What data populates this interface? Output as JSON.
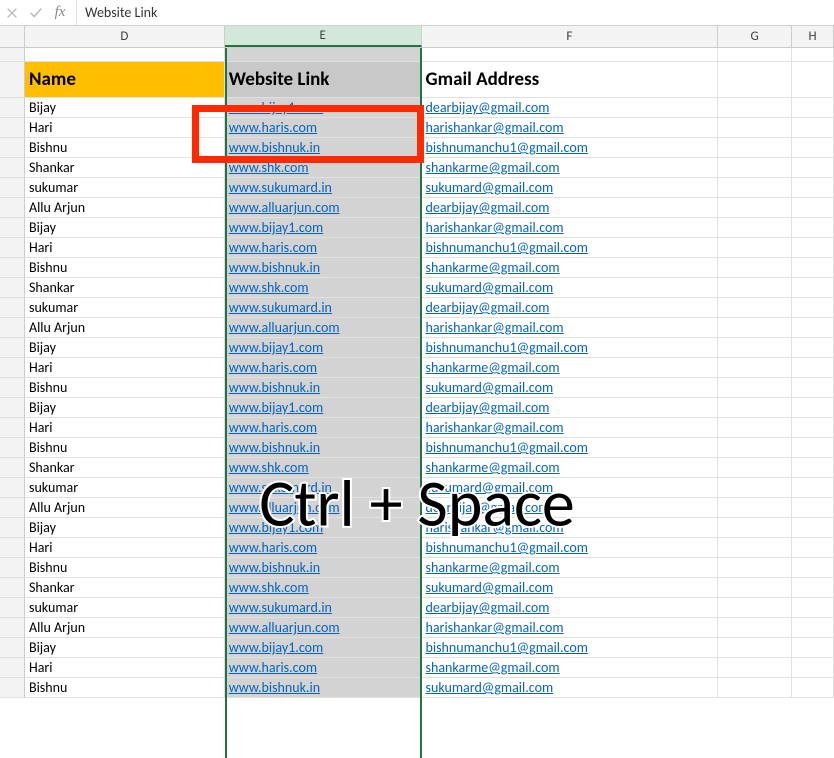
{
  "formula_bar": {
    "value": "Website Link",
    "fx": "fx"
  },
  "columns": {
    "D": "D",
    "E": "E",
    "F": "F",
    "G": "G",
    "H": "H"
  },
  "headers": {
    "name": "Name",
    "link": "Website Link",
    "email": "Gmail Address"
  },
  "overlay": "Ctrl + Space",
  "rows": [
    {
      "name": "Bijay",
      "link": "www.bijay1.com",
      "email": "dearbijay@gmail.com"
    },
    {
      "name": "Hari",
      "link": "www.haris.com",
      "email": "harishankar@gmail.com"
    },
    {
      "name": "Bishnu",
      "link": "www.bishnuk.in",
      "email": "bishnumanchu1@gmail.com"
    },
    {
      "name": "Shankar",
      "link": "www.shk.com",
      "email": "shankarme@gmail.com"
    },
    {
      "name": "sukumar",
      "link": "www.sukumard.in",
      "email": "sukumard@gmail.com"
    },
    {
      "name": "Allu Arjun",
      "link": "www.alluarjun.com",
      "email": "dearbijay@gmail.com"
    },
    {
      "name": "Bijay",
      "link": "www.bijay1.com",
      "email": "harishankar@gmail.com"
    },
    {
      "name": "Hari",
      "link": "www.haris.com",
      "email": "bishnumanchu1@gmail.com"
    },
    {
      "name": "Bishnu",
      "link": "www.bishnuk.in",
      "email": "shankarme@gmail.com"
    },
    {
      "name": "Shankar",
      "link": "www.shk.com",
      "email": "sukumard@gmail.com"
    },
    {
      "name": "sukumar",
      "link": "www.sukumard.in",
      "email": "dearbijay@gmail.com"
    },
    {
      "name": "Allu Arjun",
      "link": "www.alluarjun.com",
      "email": "harishankar@gmail.com"
    },
    {
      "name": "Bijay",
      "link": "www.bijay1.com",
      "email": "bishnumanchu1@gmail.com"
    },
    {
      "name": "Hari",
      "link": "www.haris.com",
      "email": "shankarme@gmail.com"
    },
    {
      "name": "Bishnu",
      "link": "www.bishnuk.in",
      "email": "sukumard@gmail.com"
    },
    {
      "name": "Bijay",
      "link": "www.bijay1.com",
      "email": "dearbijay@gmail.com"
    },
    {
      "name": "Hari",
      "link": "www.haris.com",
      "email": "harishankar@gmail.com"
    },
    {
      "name": "Bishnu",
      "link": "www.bishnuk.in",
      "email": "bishnumanchu1@gmail.com"
    },
    {
      "name": "Shankar",
      "link": "www.shk.com",
      "email": "shankarme@gmail.com"
    },
    {
      "name": "sukumar",
      "link": "www.sukumard.in",
      "email": "sukumard@gmail.com"
    },
    {
      "name": "Allu Arjun",
      "link": "www.alluarjun.com",
      "email": "dearbijay@gmail.com"
    },
    {
      "name": "Bijay",
      "link": "www.bijay1.com",
      "email": "harishankar@gmail.com"
    },
    {
      "name": "Hari",
      "link": "www.haris.com",
      "email": "bishnumanchu1@gmail.com"
    },
    {
      "name": "Bishnu",
      "link": "www.bishnuk.in",
      "email": "shankarme@gmail.com"
    },
    {
      "name": "Shankar",
      "link": "www.shk.com",
      "email": "sukumard@gmail.com"
    },
    {
      "name": "sukumar",
      "link": "www.sukumard.in",
      "email": "dearbijay@gmail.com"
    },
    {
      "name": "Allu Arjun",
      "link": "www.alluarjun.com",
      "email": "harishankar@gmail.com"
    },
    {
      "name": "Bijay",
      "link": "www.bijay1.com",
      "email": "bishnumanchu1@gmail.com"
    },
    {
      "name": "Hari",
      "link": "www.haris.com",
      "email": "shankarme@gmail.com"
    },
    {
      "name": "Bishnu",
      "link": "www.bishnuk.in",
      "email": "sukumard@gmail.com"
    }
  ]
}
